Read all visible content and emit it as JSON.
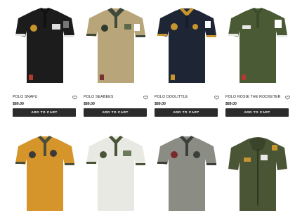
{
  "products": [
    {
      "name": "POLO SNAFU",
      "price": "$89.00",
      "button": "ADD TO CART",
      "color": "#1c1c1c",
      "collar": "#1c1c1c",
      "accent": "#f2f2f2"
    },
    {
      "name": "POLO SEABEES",
      "price": "$89.00",
      "button": "ADD TO CART",
      "color": "#b9a57a",
      "collar": "#3f4a3a",
      "accent": "#2f3a2c"
    },
    {
      "name": "POLO DOOLITTLE",
      "price": "$89.00",
      "button": "ADD TO CART",
      "color": "#1e2636",
      "collar": "#1e2636",
      "accent": "#c8942d"
    },
    {
      "name": "POLO ROSIE THE ROCKETER",
      "price": "$89.00",
      "button": "ADD TO CART",
      "color": "#4a5a35",
      "collar": "#4a5a35",
      "accent": "#ffffff"
    },
    {
      "name": "",
      "color": "#d6952a",
      "collar": "#4a4f3c",
      "accent": "#3a3a3a"
    },
    {
      "name": "",
      "color": "#e9e9e4",
      "collar": "#4a5538",
      "accent": "#4a5538"
    },
    {
      "name": "",
      "color": "#8b8c84",
      "collar": "#3a3f3a",
      "accent": "#3a3f3a"
    },
    {
      "name": "",
      "color": "#4a5535",
      "collar": "#4a5535",
      "accent": "#e8e8e8"
    }
  ]
}
